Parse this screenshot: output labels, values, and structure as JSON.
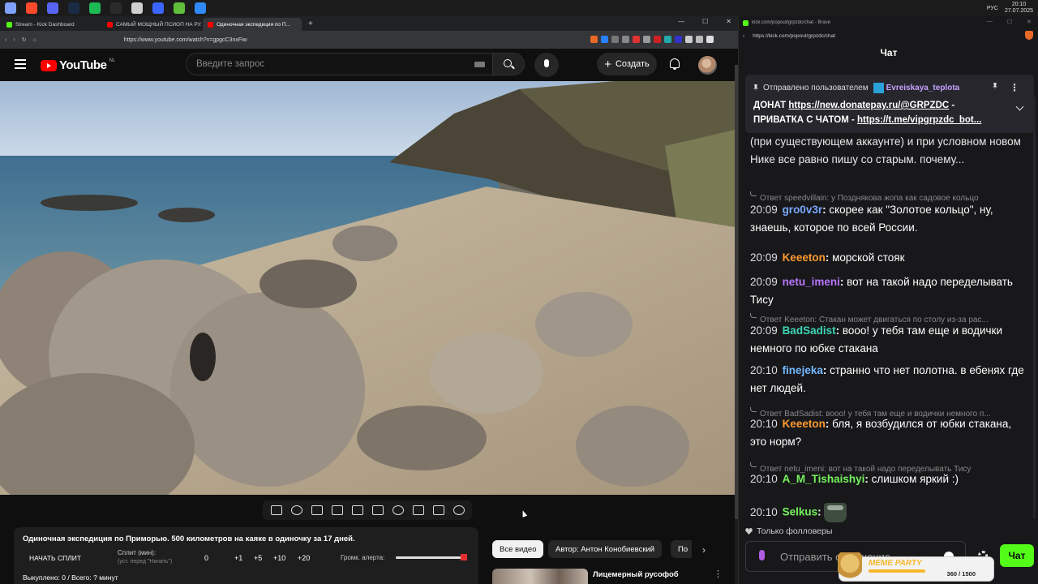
{
  "taskbar": {
    "lang": "РУС",
    "time": "20:10",
    "date": "27.07.2025",
    "colors": [
      "#7fa2ff",
      "#fc4a2a",
      "#5865f2",
      "#1a2b45",
      "#1db954",
      "#2b2b2b",
      "#cfcfcf",
      "#3a66ff",
      "#5fbf3a",
      "#2f8af7"
    ]
  },
  "browser_left": {
    "tabs": [
      {
        "label": "Stream - Kick Dashboard",
        "favicon_color": "#53fc18",
        "active": false
      },
      {
        "label": "САМЫЙ МОЩНЫЙ ПСИОП НА РУ...",
        "favicon_color": "#ff0000",
        "active": false
      },
      {
        "label": "Одиночная экспедиция по П...",
        "favicon_color": "#ff0000",
        "active": true
      }
    ],
    "new_tab": "+",
    "url": "https://www.youtube.com/watch?v=gpgcC3nxFiw"
  },
  "youtube": {
    "logo_text": "YouTube",
    "region": "NL",
    "search_placeholder": "Введите запрос",
    "create_label": "Создать",
    "tool_icons": [
      "loop-icon",
      "broadcast-icon",
      "eye-icon",
      "film-icon",
      "picture-icon",
      "subtitles-icon",
      "speed-icon",
      "add-icon",
      "camera-icon",
      "gear-icon"
    ],
    "split_panel": {
      "title": "Одиночная экспедиция по Приморью. 500 километров на каяке в одиночку за 17 дней.",
      "start_split": "НАЧАТЬ СПЛИТ",
      "split_min_label": "Сплит (мин):",
      "split_min_sub": "(уст. перед \"Начать\")",
      "value": "0",
      "steps": [
        "+1",
        "+5",
        "+10",
        "+20"
      ],
      "alert_volume_label": "Громк. алерта:",
      "alert_volume_level": 0.98,
      "footer": "Выкуплено: 0 / Всего: ? минут"
    },
    "chips": [
      "Все видео",
      "Автор: Антон Конобиевский",
      "По"
    ],
    "related": {
      "title": "Лицемерный русофоб"
    }
  },
  "browser_right": {
    "title": "kick.com/popout/grpzdc/chat - Brave",
    "url": "https://kick.com/popout/grpzdc/chat"
  },
  "chat": {
    "header": "Чат",
    "pinned": {
      "prefix": "Отправлено пользователем",
      "user": "Evreiskaya_teplota",
      "line1_text": "ДОНАТ ",
      "line1_link": "https://new.donatepay.ru/@GRPZDC",
      "line1_tail": " -",
      "line2_text": "ПРИВАТКА С ЧАТОМ - ",
      "line2_link": "https://t.me/vipgrpzdc_bot..."
    },
    "top_partial": "(при существующем аккаунте) и при условном новом Нике все равно пишу со старым. почему...",
    "messages": [
      {
        "reply": "Ответ speedvillain: у Позднякова жопа как садовое кольцо",
        "time": "20:09",
        "user": "gro0v3r",
        "color": "#7aa7ff",
        "text": "скорее как \"Золотое кольцо\", ну, знаешь, которое по всей России."
      },
      {
        "reply": "",
        "time": "20:09",
        "user": "Keeeton",
        "color": "#ff9a2e",
        "text": "морской стояк"
      },
      {
        "reply": "",
        "time": "20:09",
        "user": "netu_imeni",
        "color": "#b875ff",
        "text": "вот на такой надо переделывать Тису"
      },
      {
        "reply": "Ответ Keeeton: Стакан может двигаться по столу из-за рас...",
        "time": "20:09",
        "user": "BadSadist",
        "color": "#3dd6b5",
        "text": "вооо! у тебя там еще и водички немного по юбке стакана"
      },
      {
        "reply": "",
        "time": "20:10",
        "user": "finejeka",
        "color": "#74b8ff",
        "text": "странно что нет полотна. в ебенях где нет людей."
      },
      {
        "reply": "Ответ BadSadist: вооо! у тебя там еще и водички немного п...",
        "time": "20:10",
        "user": "Keeeton",
        "color": "#ff9a2e",
        "text": "бля, я возбудился от юбки стакана, это норм?"
      },
      {
        "reply": "Ответ netu_imeni: вот на такой надо переделывать Тису",
        "time": "20:10",
        "user": "A_M_Tishaishyi",
        "color": "#74f25b",
        "text": "слишком яркий :)"
      },
      {
        "reply": "",
        "time": "20:10",
        "user": "Selkus",
        "color": "#74f25b",
        "text": ""
      }
    ],
    "followers_only": "Только фолловеры",
    "input_placeholder": "Отправить сообщение...",
    "send_label": "Чат",
    "meme_party": {
      "title": "MEME PARTY",
      "count": "360 / 1500"
    }
  }
}
